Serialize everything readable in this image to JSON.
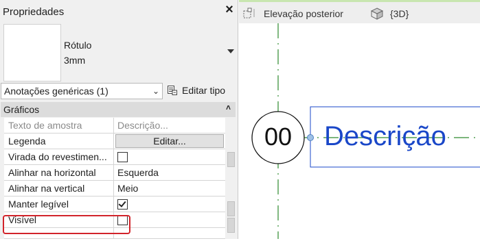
{
  "properties": {
    "title": "Propriedades",
    "close_icon": "×",
    "family_name": "Rótulo",
    "family_type": "3mm",
    "filter_value": "Anotações genéricas (1)",
    "edit_type_label": "Editar tipo",
    "group_label": "Gráficos",
    "rows": [
      {
        "name": "Texto de amostra",
        "value": "Descrição...",
        "disabled": true
      },
      {
        "name": "Legenda",
        "button": "Editar..."
      },
      {
        "name": "Virada do revestimen...",
        "checkbox": false
      },
      {
        "name": "Alinhar na horizontal",
        "value": "Esquerda"
      },
      {
        "name": "Alinhar na vertical",
        "value": "Meio"
      },
      {
        "name": "Manter legível",
        "checkbox": true
      },
      {
        "name": "Visível",
        "checkbox": false
      }
    ]
  },
  "views": {
    "tab1_label": "Elevação posterior",
    "tab2_label": "{3D}"
  },
  "canvas": {
    "tag_number": "00",
    "tag_label": "Descrição"
  },
  "colors": {
    "tag_text": "#1a47c8",
    "gridline": "#2d8a2d",
    "highlight": "#d2232a"
  }
}
